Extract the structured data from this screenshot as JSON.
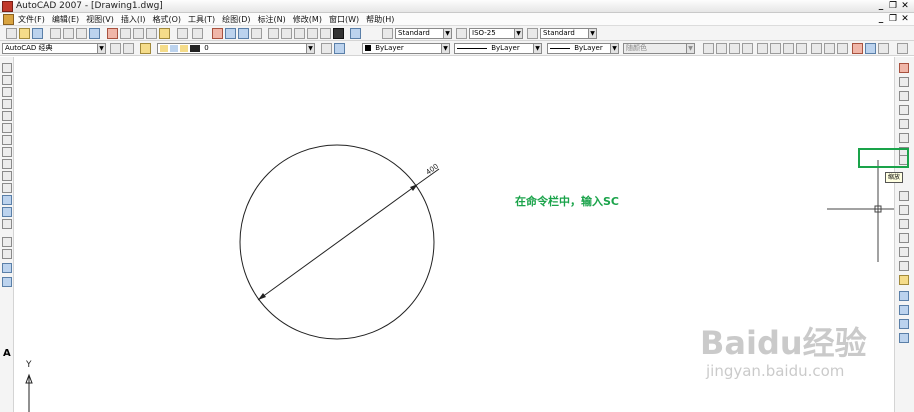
{
  "window": {
    "title": "AutoCAD 2007 - [Drawing1.dwg]",
    "buttons": [
      "_",
      "❐",
      "✕"
    ]
  },
  "menu": {
    "items": [
      "文件(F)",
      "编辑(E)",
      "视图(V)",
      "插入(I)",
      "格式(O)",
      "工具(T)",
      "绘图(D)",
      "标注(N)",
      "修改(M)",
      "窗口(W)",
      "帮助(H)"
    ],
    "doc_buttons": [
      "_",
      "❐",
      "✕"
    ]
  },
  "toolbar1": {
    "text_style": "Standard",
    "dim_style": "ISO-25",
    "table_style": "Standard"
  },
  "toolbar2": {
    "workspace": "AutoCAD 经典",
    "layer": "0",
    "color": "ByLayer",
    "linetype": "ByLayer",
    "lineweight": "ByLayer",
    "plot_style": "随颜色"
  },
  "left_toolbar": {
    "text_tool_letter": "A"
  },
  "drawing": {
    "dimension_text": "400",
    "ucs_y_label": "Y"
  },
  "instruction": {
    "text": "在命令栏中，输入SC"
  },
  "tooltip": {
    "text": "缩放"
  },
  "watermark": {
    "brand": "Baidu经验",
    "url": "jingyan.baidu.com"
  },
  "colors": {
    "instruction_green": "#1aa34a",
    "highlight_green": "#1aa34a"
  }
}
